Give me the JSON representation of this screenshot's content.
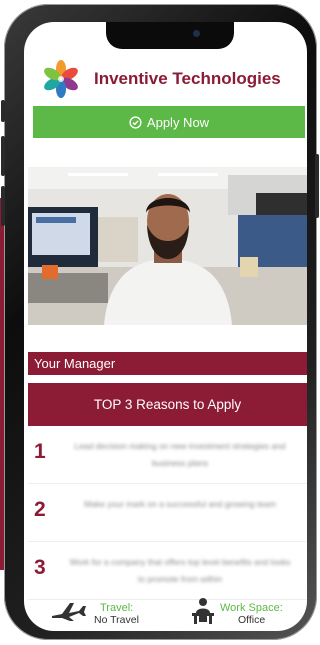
{
  "header": {
    "company_name": "Inventive Technologies"
  },
  "apply": {
    "label": "Apply Now"
  },
  "manager": {
    "label": "Your Manager"
  },
  "reasons": {
    "title": "TOP 3 Reasons to Apply",
    "items": [
      {
        "number": "1",
        "text": "Lead decision making on new investment strategies and business plans"
      },
      {
        "number": "2",
        "text": "Make your mark on a successful and growing team"
      },
      {
        "number": "3",
        "text": "Work for a company that offers top level benefits and looks to promote from within"
      }
    ]
  },
  "footer": {
    "travel_label": "Travel:",
    "travel_value": "No Travel",
    "workspace_label": "Work Space:",
    "workspace_value": "Office"
  },
  "colors": {
    "brand": "#8c1b35",
    "accent_green": "#5cb947"
  },
  "icons": [
    "logo-icon",
    "check-circle-icon",
    "airplane-icon",
    "desk-worker-icon"
  ]
}
